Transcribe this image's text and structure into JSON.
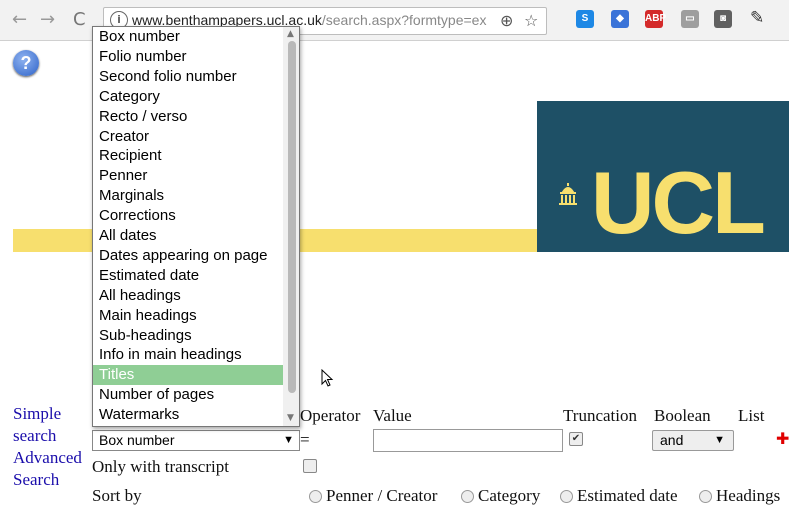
{
  "browser": {
    "url_domain": "www.benthampapers.ucl.ac.uk",
    "url_path": "/search.aspx?formtype=ex",
    "extensions": [
      {
        "name": "s-extension-icon",
        "label": "S",
        "color": "#1e88e5"
      },
      {
        "name": "send-extension-icon",
        "label": "◆",
        "color": "#3a73d8"
      },
      {
        "name": "abp-extension-icon",
        "label": "ABP",
        "color": "#d42a2a"
      },
      {
        "name": "page-extension-icon",
        "label": "▭",
        "color": "#9e9e9e"
      },
      {
        "name": "lightbulb-extension-icon",
        "label": "◙",
        "color": "#616161"
      }
    ]
  },
  "page": {
    "help_icon": "?",
    "logo_text": "UCL",
    "links": {
      "simple_search": "Simple search",
      "advanced_search": "Advanced Search"
    },
    "headers": {
      "operator": "Operator",
      "value": "Value",
      "truncation": "Truncation",
      "boolean": "Boolean",
      "list": "List"
    },
    "operator_value": "=",
    "value_input": "",
    "truncation_checked": true,
    "boolean_select": "and",
    "add_row": "✚",
    "field_select": "Box number",
    "only_with_transcript": "Only with transcript",
    "sort_by": "Sort by",
    "sort_options": [
      "Penner / Creator",
      "Category",
      "Estimated date",
      "Headings"
    ]
  },
  "dropdown": {
    "options": [
      "Box number",
      "Folio number",
      "Second folio number",
      "Category",
      "Recto / verso",
      "Creator",
      "Recipient",
      "Penner",
      "Marginals",
      "Corrections",
      "All dates",
      "Dates appearing on page",
      "Estimated date",
      "All headings",
      "Main headings",
      "Sub-headings",
      "Info in main headings",
      "Titles",
      "Number of pages",
      "Watermarks"
    ],
    "highlighted": "Titles"
  }
}
